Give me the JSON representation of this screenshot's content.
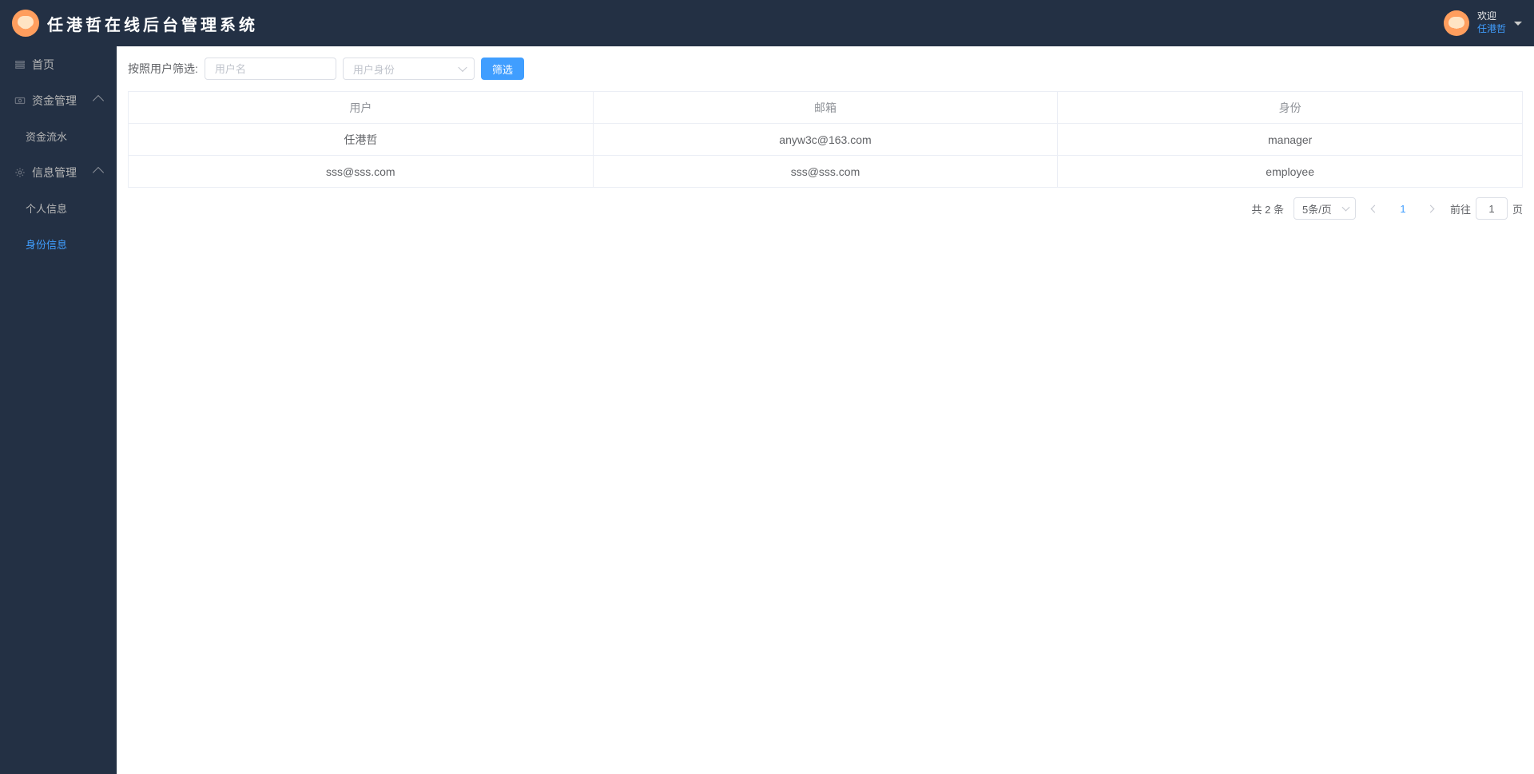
{
  "header": {
    "title": "任港哲在线后台管理系统",
    "welcome_text": "欢迎",
    "welcome_name": "任港哲"
  },
  "sidebar": {
    "home": "首页",
    "funds": "资金管理",
    "funds_flow": "资金流水",
    "info": "信息管理",
    "personal": "个人信息",
    "identity": "身份信息"
  },
  "filter": {
    "label": "按照用户筛选:",
    "username_placeholder": "用户名",
    "identity_placeholder": "用户身份",
    "button": "筛选"
  },
  "table": {
    "headers": {
      "user": "用户",
      "email": "邮箱",
      "identity": "身份"
    },
    "rows": [
      {
        "user": "任港哲",
        "email": "anyw3c@163.com",
        "identity": "manager"
      },
      {
        "user": "sss@sss.com",
        "email": "sss@sss.com",
        "identity": "employee"
      }
    ]
  },
  "pagination": {
    "total_text": "共 2 条",
    "page_size_text": "5条/页",
    "current_page": "1",
    "jump_prefix": "前往",
    "jump_value": "1",
    "jump_suffix": "页"
  }
}
